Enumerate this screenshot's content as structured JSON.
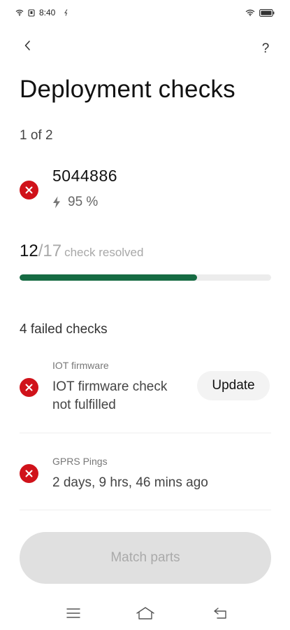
{
  "status_bar": {
    "time": "8:40"
  },
  "header": {
    "title": "Deployment checks",
    "help_label": "?"
  },
  "pager": {
    "text": "1 of 2"
  },
  "device": {
    "id": "5044886",
    "battery": "95 %"
  },
  "progress": {
    "resolved": "12",
    "slash": "/",
    "total": "17",
    "label": "check resolved",
    "fraction": 0.705
  },
  "failed": {
    "heading": "4 failed checks",
    "items": [
      {
        "category": "IOT firmware",
        "line1": "IOT firmware check",
        "line2": "not fulfilled",
        "action": "Update"
      },
      {
        "category": "GPRS Pings",
        "line1": "2 days, 9 hrs, 46 mins ago"
      }
    ]
  },
  "footer": {
    "match_label": "Match parts"
  },
  "colors": {
    "error": "#d0121a",
    "progress": "#166b43",
    "disabled_button": "#e0e0e0"
  }
}
